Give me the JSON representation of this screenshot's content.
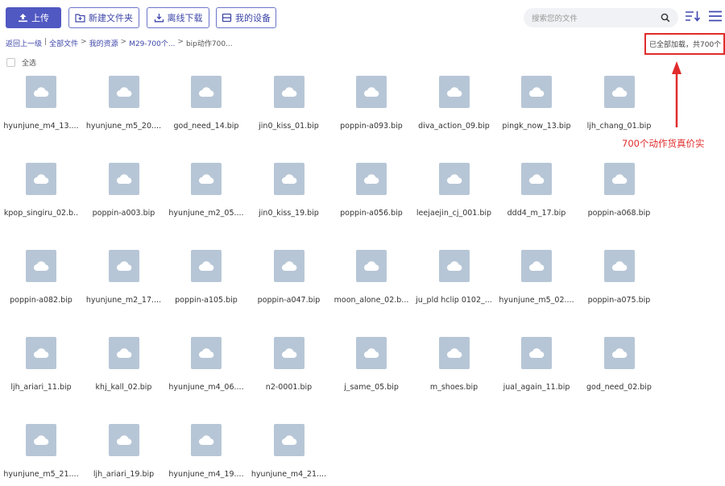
{
  "toolbar": {
    "upload_label": "上传",
    "new_folder_label": "新建文件夹",
    "offline_download_label": "离线下载",
    "my_device_label": "我的设备",
    "search_placeholder": "搜索您的文件"
  },
  "breadcrumb": {
    "back": "返回上一级",
    "all_files": "全部文件",
    "my_resources": "我的资源",
    "folder1": "M29-700个...",
    "folder2": "bip动作700..."
  },
  "status_text": "已全部加载，共700个",
  "select_all_label": "全选",
  "annotation_text": "700个动作货真价实",
  "colors": {
    "accent": "#5058c2",
    "annotation": "#e02c2c",
    "thumb": "#b7c6d6"
  },
  "files": [
    [
      "hyunjune_m4_13....",
      "hyunjune_m5_20....",
      "god_need_14.bip",
      "jin0_kiss_01.bip",
      "poppin-a093.bip",
      "diva_action_09.bip",
      "pingk_now_13.bip",
      "ljh_chang_01.bip"
    ],
    [
      "kpop_singiru_02.b..",
      "poppin-a003.bip",
      "hyunjune_m2_05....",
      "jin0_kiss_19.bip",
      "poppin-a056.bip",
      "leejaejin_cj_001.bip",
      "ddd4_m_17.bip",
      "poppin-a068.bip"
    ],
    [
      "poppin-a082.bip",
      "hyunjune_m2_17....",
      "poppin-a105.bip",
      "poppin-a047.bip",
      "moon_alone_02.b...",
      "ju_pld hclip 0102_...",
      "hyunjune_m5_02....",
      "poppin-a075.bip"
    ],
    [
      "ljh_ariari_11.bip",
      "khj_kall_02.bip",
      "hyunjune_m4_06....",
      "n2-0001.bip",
      "j_same_05.bip",
      "m_shoes.bip",
      "jual_again_11.bip",
      "god_need_02.bip"
    ],
    [
      "hyunjune_m5_21....",
      "ljh_ariari_19.bip",
      "hyunjune_m4_19....",
      "hyunjune_m4_21...."
    ]
  ]
}
